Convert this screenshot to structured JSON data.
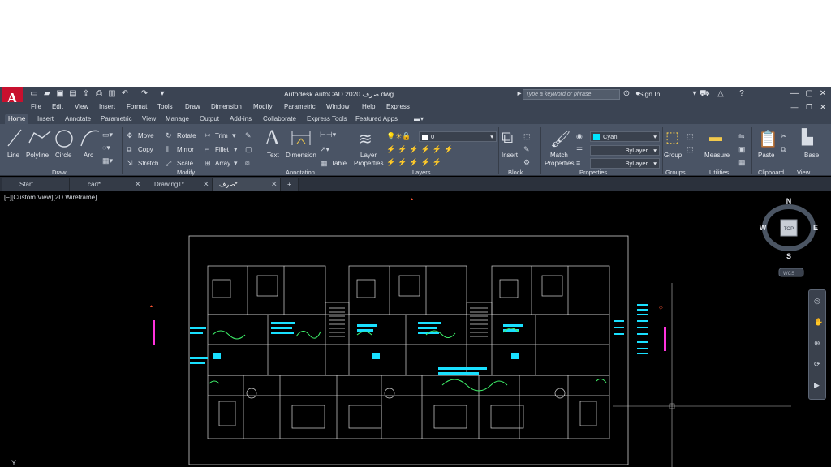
{
  "app_title": "Autodesk AutoCAD 2020   صرف.dwg",
  "logo": "A",
  "search_placeholder": "Type a keyword or phrase",
  "signin": "Sign In",
  "menus": [
    "File",
    "Edit",
    "View",
    "Insert",
    "Format",
    "Tools",
    "Draw",
    "Dimension",
    "Modify",
    "Parametric",
    "Window",
    "Help",
    "Express"
  ],
  "ribbon_tabs": [
    "Home",
    "Insert",
    "Annotate",
    "Parametric",
    "View",
    "Manage",
    "Output",
    "Add-ins",
    "Collaborate",
    "Express Tools",
    "Featured Apps"
  ],
  "draw": {
    "line": "Line",
    "polyline": "Polyline",
    "circle": "Circle",
    "arc": "Arc",
    "title": "Draw"
  },
  "modify": {
    "move": "Move",
    "rotate": "Rotate",
    "trim": "Trim",
    "copy": "Copy",
    "mirror": "Mirror",
    "fillet": "Fillet",
    "stretch": "Stretch",
    "scale": "Scale",
    "array": "Array",
    "title": "Modify"
  },
  "annotation": {
    "text": "Text",
    "dimension": "Dimension",
    "table": "Table",
    "title": "Annotation"
  },
  "layers": {
    "layer_properties": "Layer Properties",
    "current_layer": "0",
    "title": "Layers"
  },
  "block": {
    "insert": "Insert",
    "title": "Block"
  },
  "properties": {
    "match": "Match Properties",
    "color": "Cyan",
    "linetype": "ByLayer",
    "lineweight": "ByLayer",
    "title": "Properties",
    "color_hex": "#00e5ff"
  },
  "groups": {
    "group": "Group",
    "title": "Groups"
  },
  "utilities": {
    "measure": "Measure",
    "title": "Utilities"
  },
  "clipboard": {
    "paste": "Paste",
    "title": "Clipboard"
  },
  "view_panel": {
    "base": "Base",
    "title": "View"
  },
  "file_tabs": [
    "Start",
    "cad*",
    "Drawing1*",
    "صرف*"
  ],
  "viewport_label": "[−][Custom View][2D Wireframe]",
  "viewcube": {
    "n": "N",
    "s": "S",
    "e": "E",
    "w": "W",
    "top": "TOP",
    "wcs": "WCS"
  }
}
